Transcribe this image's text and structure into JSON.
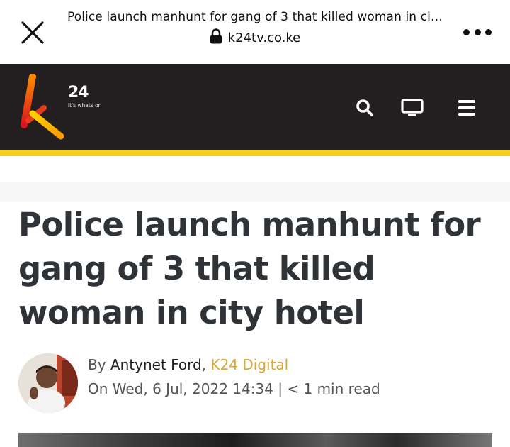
{
  "browser": {
    "page_title": "Police launch manhunt for gang of 3 that killed woman in ci…",
    "url": "k24tv.co.ke",
    "close_icon": "close-icon",
    "lock_icon": "lock-icon",
    "menu_icon": "more-dots-icon"
  },
  "header": {
    "logo_number": "24",
    "logo_tagline": "it's whats on",
    "icons": [
      "search-icon",
      "tv-icon",
      "hamburger-menu-icon"
    ],
    "colors": {
      "background": "#231f20",
      "stripe": "#f7d117",
      "accent": "#d4a83a"
    }
  },
  "article": {
    "headline": "Police launch manhunt for gang of 3 that killed woman in city hotel",
    "by_prefix": "By ",
    "author": "Antynet Ford",
    "separator": ", ",
    "outlet": "K24 Digital",
    "dateline": "On Wed, 6 Jul, 2022 14:34 | < 1 min read"
  }
}
